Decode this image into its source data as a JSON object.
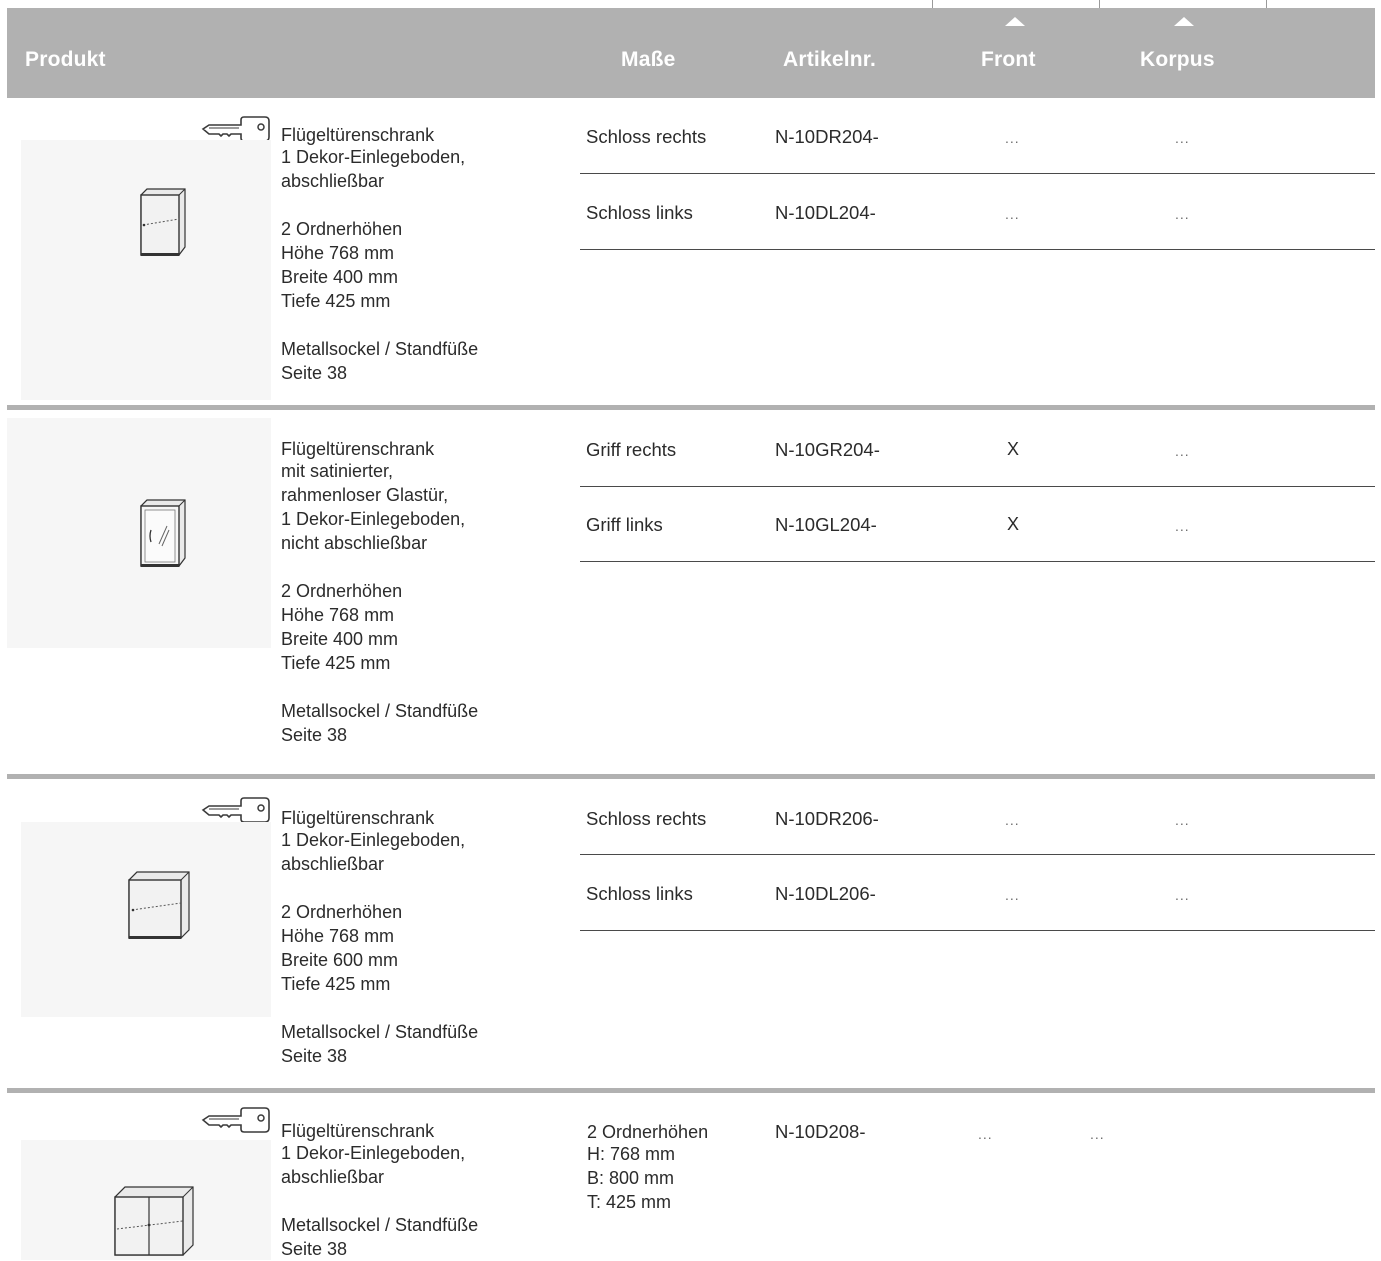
{
  "header": {
    "produkt": "Produkt",
    "masse": "Maße",
    "artikelnr": "Artikelnr.",
    "front": "Front",
    "korpus": "Korpus"
  },
  "products": [
    {
      "lockable": true,
      "icon": "cabinet-single-door-icon",
      "description": [
        "Flügeltürenschrank",
        "1 Dekor-Einlegeboden,",
        "abschließbar",
        "",
        "2 Ordnerhöhen",
        "Höhe 768 mm",
        "Breite 400 mm",
        "Tiefe 425 mm",
        "",
        "Metallsockel / Standfüße",
        "Seite 38"
      ],
      "rows": [
        {
          "masse": "Schloss rechts",
          "artikel": "N-10DR204-",
          "front": "...",
          "korpus": "..."
        },
        {
          "masse": "Schloss links",
          "artikel": "N-10DL204-",
          "front": "...",
          "korpus": "..."
        }
      ]
    },
    {
      "lockable": false,
      "icon": "cabinet-glass-door-icon",
      "description": [
        "Flügeltürenschrank",
        "mit satinierter,",
        "rahmenloser Glastür,",
        "1 Dekor-Einlegeboden,",
        "nicht abschließbar",
        "",
        "2 Ordnerhöhen",
        "Höhe 768 mm",
        "Breite 400 mm",
        "Tiefe 425 mm",
        "",
        "Metallsockel / Standfüße",
        "Seite 38"
      ],
      "rows": [
        {
          "masse": "Griff rechts",
          "artikel": "N-10GR204-",
          "front": "X",
          "korpus": "..."
        },
        {
          "masse": "Griff links",
          "artikel": "N-10GL204-",
          "front": "X",
          "korpus": "..."
        }
      ]
    },
    {
      "lockable": true,
      "icon": "cabinet-wide-door-icon",
      "description": [
        "Flügeltürenschrank",
        "1 Dekor-Einlegeboden,",
        "abschließbar",
        "",
        "2 Ordnerhöhen",
        "Höhe 768 mm",
        "Breite 600 mm",
        "Tiefe 425 mm",
        "",
        "Metallsockel / Standfüße",
        "Seite 38"
      ],
      "rows": [
        {
          "masse": "Schloss rechts",
          "artikel": "N-10DR206-",
          "front": "...",
          "korpus": "..."
        },
        {
          "masse": "Schloss links",
          "artikel": "N-10DL206-",
          "front": "...",
          "korpus": "..."
        }
      ]
    },
    {
      "lockable": true,
      "icon": "cabinet-double-door-icon",
      "description": [
        "Flügeltürenschrank",
        "1 Dekor-Einlegeboden,",
        "abschließbar",
        "",
        "Metallsockel / Standfüße",
        "Seite 38"
      ],
      "masse_lines": [
        "2 Ordnerhöhen",
        "H: 768 mm",
        "B: 800 mm",
        "T: 425 mm"
      ],
      "artikel": "N-10D208-",
      "front": "...",
      "korpus": "..."
    }
  ]
}
